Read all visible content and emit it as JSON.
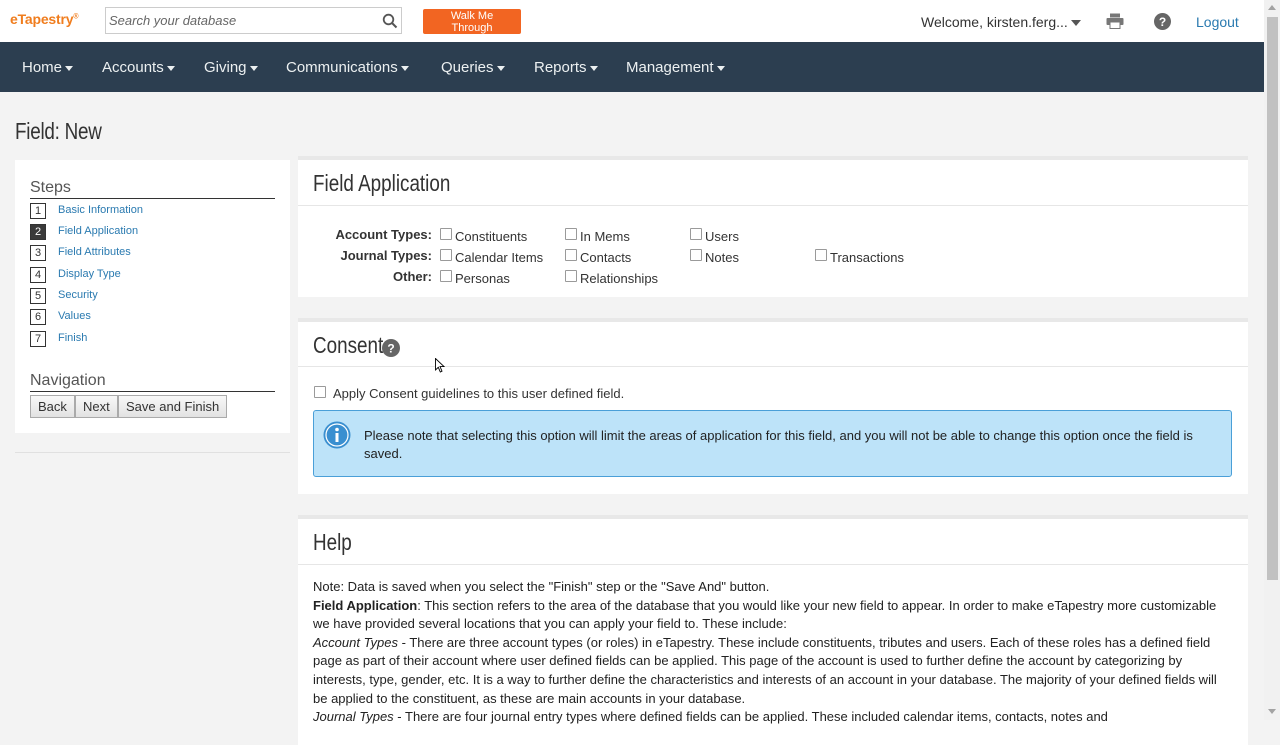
{
  "topbar": {
    "logo": "eTapestry",
    "logo_mark": "®",
    "search_placeholder": "Search your database",
    "walk_button": "Walk Me Through",
    "welcome": "Welcome, kirsten.ferg...",
    "logout": "Logout"
  },
  "nav": {
    "items": [
      "Home",
      "Accounts",
      "Giving",
      "Communications",
      "Queries",
      "Reports",
      "Management"
    ]
  },
  "page": {
    "title": "Field: New"
  },
  "steps": {
    "heading": "Steps",
    "items": [
      {
        "num": "1",
        "label": "Basic Information"
      },
      {
        "num": "2",
        "label": "Field Application"
      },
      {
        "num": "3",
        "label": "Field Attributes"
      },
      {
        "num": "4",
        "label": "Display Type"
      },
      {
        "num": "5",
        "label": "Security"
      },
      {
        "num": "6",
        "label": "Values"
      },
      {
        "num": "7",
        "label": "Finish"
      }
    ],
    "active_step": "2"
  },
  "navigation": {
    "heading": "Navigation",
    "back": "Back",
    "next": "Next",
    "save_finish": "Save and Finish"
  },
  "field_application": {
    "title": "Field Application",
    "account_types_label": "Account Types:",
    "journal_types_label": "Journal Types:",
    "other_label": "Other:",
    "account_types": [
      "Constituents",
      "In Mems",
      "Users"
    ],
    "journal_types": [
      "Calendar Items",
      "Contacts",
      "Notes",
      "Transactions"
    ],
    "other": [
      "Personas",
      "Relationships"
    ]
  },
  "consent": {
    "title": "Consent",
    "checkbox_label": "Apply Consent guidelines to this user defined field.",
    "info": "Please note that selecting this option will limit the areas of application for this field, and you will not be able to change this option once the field is saved."
  },
  "help": {
    "title": "Help",
    "note": "Note: Data is saved when you select the \"Finish\" step or the \"Save And\" button.",
    "fa_term": "Field Application",
    "fa_text": ": This section refers to the area of the database that you would like your new field to appear. In order to make eTapestry more customizable we have provided several locations that you can apply your field to. These include:",
    "at_term": "Account Types",
    "at_text": " - There are three account types (or roles) in eTapestry. These include constituents, tributes and users. Each of these roles has a defined field page as part of their account where user defined fields can be applied. This page of the account is used to further define the account by categorizing by interests, type, gender, etc. It is a way to further define the characteristics and interests of an account in your database. The majority of your defined fields will be applied to the constituent, as these are main accounts in your database.",
    "jt_term": "Journal Types",
    "jt_text": " - There are four journal entry types where defined fields can be applied. These included calendar items, contacts, notes and"
  },
  "colors": {
    "nav_bg": "#2c3e50",
    "walk_button": "#f26522",
    "link": "#2a7ab0",
    "info_bg": "#bde3f9"
  }
}
